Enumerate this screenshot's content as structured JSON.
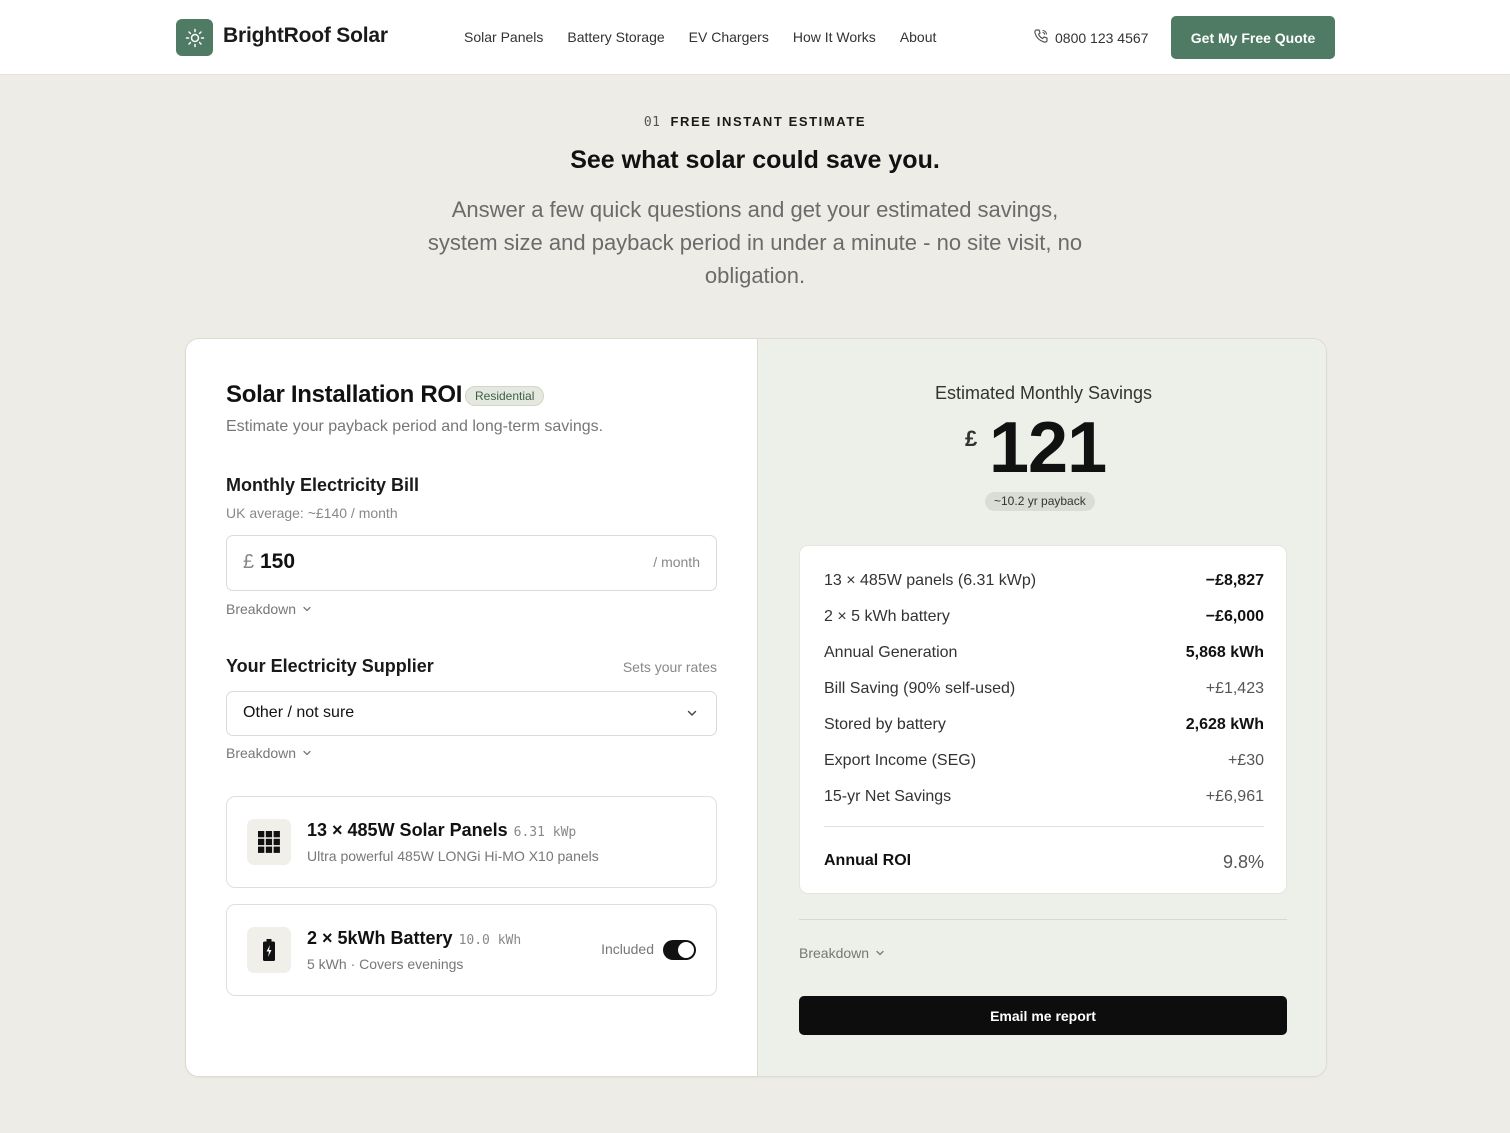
{
  "header": {
    "brand": "BrightRoof Solar",
    "logo_icon": "sun-icon",
    "nav": [
      "Solar Panels",
      "Battery Storage",
      "EV Chargers",
      "How It Works",
      "About"
    ],
    "phone": "0800 123 4567",
    "cta_label": "Get My Free Quote",
    "accent_color": "#4f7a63"
  },
  "hero": {
    "step": "01",
    "eyebrow": "FREE INSTANT ESTIMATE",
    "title": "See what solar could save you.",
    "subtitle": "Answer a few quick questions and get your estimated savings, system size and payback period in under a minute - no site visit, no obligation."
  },
  "calculator": {
    "title": "Solar Installation ROI",
    "badge": "Residential",
    "subtitle": "Estimate your payback period and long-term savings.",
    "bill": {
      "label": "Monthly Electricity Bill",
      "hint": "UK average: ~£140 / month",
      "currency": "£",
      "value": "150",
      "unit": "/ month",
      "breakdown": "Breakdown"
    },
    "supplier": {
      "label": "Your Electricity Supplier",
      "hint": "Sets your rates",
      "selected": "Other / not sure",
      "breakdown": "Breakdown"
    },
    "products": [
      {
        "icon": "solar-panel-icon",
        "title": "13 × 485W Solar Panels",
        "spec": "6.31 kWp",
        "desc": "Ultra powerful 485W LONGi Hi-MO X10 panels"
      },
      {
        "icon": "battery-icon",
        "title": "2 × 5kWh Battery",
        "spec": "10.0 kWh",
        "desc": "5 kWh · Covers evenings",
        "included_label": "Included",
        "included": true
      }
    ]
  },
  "results": {
    "label": "Estimated Monthly Savings",
    "currency": "£",
    "amount": "121",
    "payback": "~10.2 yr payback",
    "rows": [
      {
        "k": "13 × 485W panels (6.31 kWp)",
        "v": "−£8,827"
      },
      {
        "k": "2 × 5 kWh battery",
        "v": "−£6,000"
      },
      {
        "k": "Annual Generation",
        "v": "5,868 kWh"
      },
      {
        "k": "Bill Saving (90% self-used)",
        "v": "+£1,423"
      },
      {
        "k": "Stored by battery",
        "v": "2,628 kWh"
      },
      {
        "k": "Export Income (SEG)",
        "v": "+£30"
      },
      {
        "k": "15-yr Net Savings",
        "v": "+£6,961"
      }
    ],
    "roi_label": "Annual ROI",
    "roi_value": "9.8%",
    "breakdown": "Breakdown",
    "email_label": "Email me report"
  }
}
